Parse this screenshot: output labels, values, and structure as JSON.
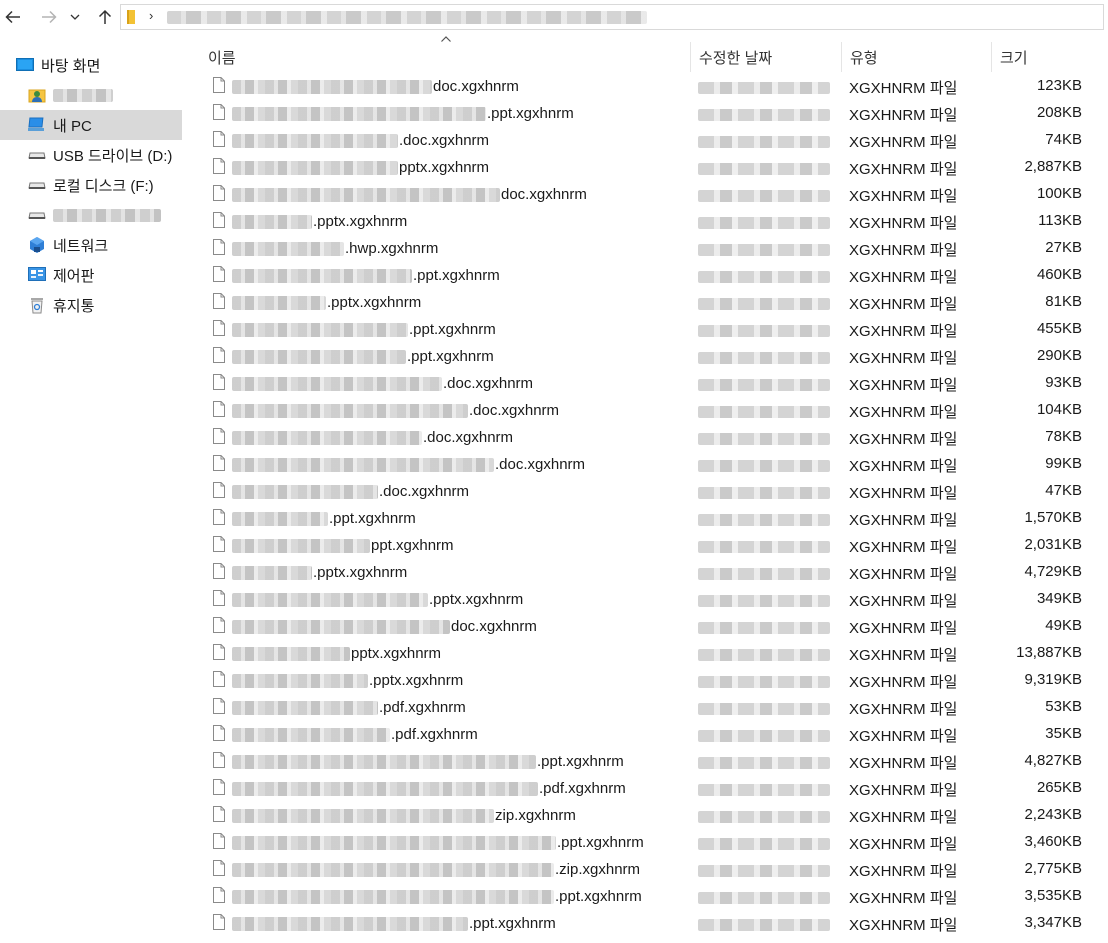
{
  "nav": {
    "back": "back-arrow",
    "forward": "forward-arrow",
    "recent": "chevron-down",
    "up": "up-arrow"
  },
  "address": {
    "separator": "›"
  },
  "sidebar": {
    "items": [
      {
        "label": "바탕 화면",
        "icon": "desktop-icon"
      },
      {
        "label": "",
        "icon": "user-folder-icon"
      },
      {
        "label": "내 PC",
        "icon": "this-pc-icon"
      },
      {
        "label": "USB 드라이브 (D:)",
        "icon": "drive-icon"
      },
      {
        "label": "로컬 디스크 (F:)",
        "icon": "drive-icon"
      },
      {
        "label": "",
        "icon": "drive-icon"
      },
      {
        "label": "네트워크",
        "icon": "network-icon"
      },
      {
        "label": "제어판",
        "icon": "control-panel-icon"
      },
      {
        "label": "휴지통",
        "icon": "recycle-bin-icon"
      }
    ]
  },
  "columns": {
    "name": "이름",
    "modified": "수정한 날짜",
    "type": "유형",
    "size": "크기"
  },
  "files": [
    {
      "ext": "doc.xgxhnrm",
      "type": "XGXHNRM 파일",
      "size": "123KB"
    },
    {
      "ext": ".ppt.xgxhnrm",
      "type": "XGXHNRM 파일",
      "size": "208KB"
    },
    {
      "ext": ".doc.xgxhnrm",
      "type": "XGXHNRM 파일",
      "size": "74KB"
    },
    {
      "ext": "pptx.xgxhnrm",
      "type": "XGXHNRM 파일",
      "size": "2,887KB"
    },
    {
      "ext": "doc.xgxhnrm",
      "type": "XGXHNRM 파일",
      "size": "100KB"
    },
    {
      "ext": ".pptx.xgxhnrm",
      "type": "XGXHNRM 파일",
      "size": "113KB"
    },
    {
      "ext": ".hwp.xgxhnrm",
      "type": "XGXHNRM 파일",
      "size": "27KB"
    },
    {
      "ext": ".ppt.xgxhnrm",
      "type": "XGXHNRM 파일",
      "size": "460KB"
    },
    {
      "ext": ".pptx.xgxhnrm",
      "type": "XGXHNRM 파일",
      "size": "81KB"
    },
    {
      "ext": ".ppt.xgxhnrm",
      "type": "XGXHNRM 파일",
      "size": "455KB"
    },
    {
      "ext": ".ppt.xgxhnrm",
      "type": "XGXHNRM 파일",
      "size": "290KB"
    },
    {
      "ext": ".doc.xgxhnrm",
      "type": "XGXHNRM 파일",
      "size": "93KB"
    },
    {
      "ext": ".doc.xgxhnrm",
      "type": "XGXHNRM 파일",
      "size": "104KB"
    },
    {
      "ext": ".doc.xgxhnrm",
      "type": "XGXHNRM 파일",
      "size": "78KB"
    },
    {
      "ext": ".doc.xgxhnrm",
      "type": "XGXHNRM 파일",
      "size": "99KB"
    },
    {
      "ext": ".doc.xgxhnrm",
      "type": "XGXHNRM 파일",
      "size": "47KB"
    },
    {
      "ext": ".ppt.xgxhnrm",
      "type": "XGXHNRM 파일",
      "size": "1,570KB"
    },
    {
      "ext": "ppt.xgxhnrm",
      "type": "XGXHNRM 파일",
      "size": "2,031KB"
    },
    {
      "ext": ".pptx.xgxhnrm",
      "type": "XGXHNRM 파일",
      "size": "4,729KB"
    },
    {
      "ext": ".pptx.xgxhnrm",
      "type": "XGXHNRM 파일",
      "size": "349KB"
    },
    {
      "ext": "doc.xgxhnrm",
      "type": "XGXHNRM 파일",
      "size": "49KB"
    },
    {
      "ext": "pptx.xgxhnrm",
      "type": "XGXHNRM 파일",
      "size": "13,887KB"
    },
    {
      "ext": ".pptx.xgxhnrm",
      "type": "XGXHNRM 파일",
      "size": "9,319KB"
    },
    {
      "ext": ".pdf.xgxhnrm",
      "type": "XGXHNRM 파일",
      "size": "53KB"
    },
    {
      "ext": ".pdf.xgxhnrm",
      "type": "XGXHNRM 파일",
      "size": "35KB"
    },
    {
      "ext": ".ppt.xgxhnrm",
      "type": "XGXHNRM 파일",
      "size": "4,827KB"
    },
    {
      "ext": ".pdf.xgxhnrm",
      "type": "XGXHNRM 파일",
      "size": "265KB"
    },
    {
      "ext": "zip.xgxhnrm",
      "type": "XGXHNRM 파일",
      "size": "2,243KB"
    },
    {
      "ext": ".ppt.xgxhnrm",
      "type": "XGXHNRM 파일",
      "size": "3,460KB"
    },
    {
      "ext": ".zip.xgxhnrm",
      "type": "XGXHNRM 파일",
      "size": "2,775KB"
    },
    {
      "ext": ".ppt.xgxhnrm",
      "type": "XGXHNRM 파일",
      "size": "3,535KB"
    },
    {
      "ext": ".ppt.xgxhnrm",
      "type": "XGXHNRM 파일",
      "size": "3,347KB"
    }
  ]
}
